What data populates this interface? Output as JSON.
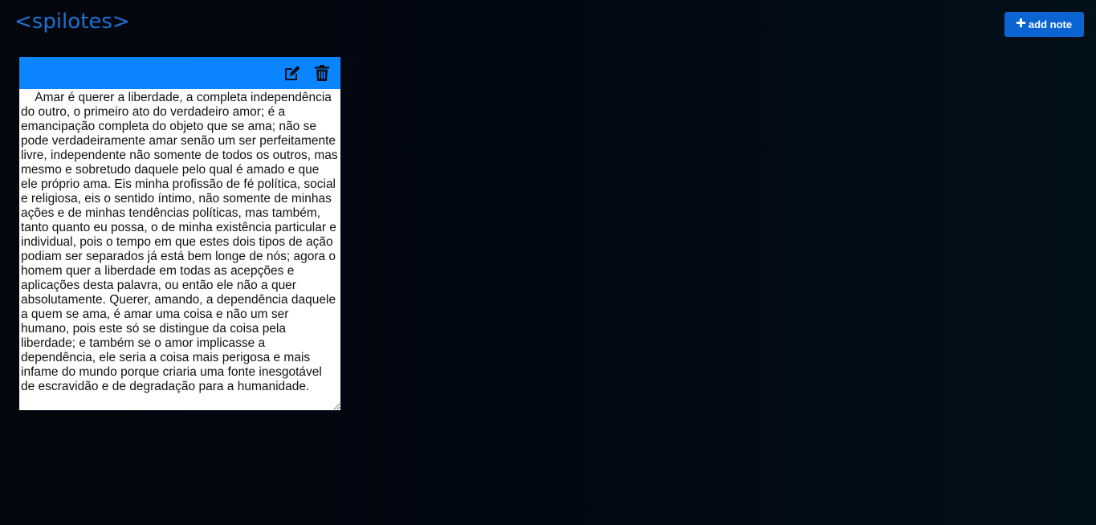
{
  "header": {
    "logo": "<spilotes>",
    "add_note_label": "add note",
    "add_note_icon": "plus-icon"
  },
  "colors": {
    "logo": "#1a72d6",
    "button": "#0a65d3",
    "note_header": "#0a84ff",
    "background": "#030812"
  },
  "notes": [
    {
      "edit_icon": "edit-icon",
      "delete_icon": "trash-icon",
      "text": "    Amar é querer a liberdade, a completa independência do outro, o primeiro ato do verdadeiro amor; é a emancipação completa do objeto que se ama; não se pode verdadeiramente amar senão um ser perfeitamente livre, independente não somente de todos os outros, mas mesmo e sobretudo daquele pelo qual é amado e que ele próprio ama. Eis minha profissão de fé política, social e religiosa, eis o sentido íntimo, não somente de minhas ações e de minhas tendências políticas, mas também, tanto quanto eu possa, o de minha existência particular e individual, pois o tempo em que estes dois tipos de ação podiam ser separados já está bem longe de nós; agora o homem quer a liberdade em todas as acepções e aplicações desta palavra, ou então ele não a quer absolutamente. Querer, amando, a dependência daquele a quem se ama, é amar uma coisa e não um ser humano, pois este só se distingue da coisa pela liberdade; e também se o amor implicasse a dependência, ele seria a coisa mais perigosa e mais infame do mundo porque criaria uma fonte inesgotável de escravidão e de degradação para a humanidade."
    }
  ]
}
